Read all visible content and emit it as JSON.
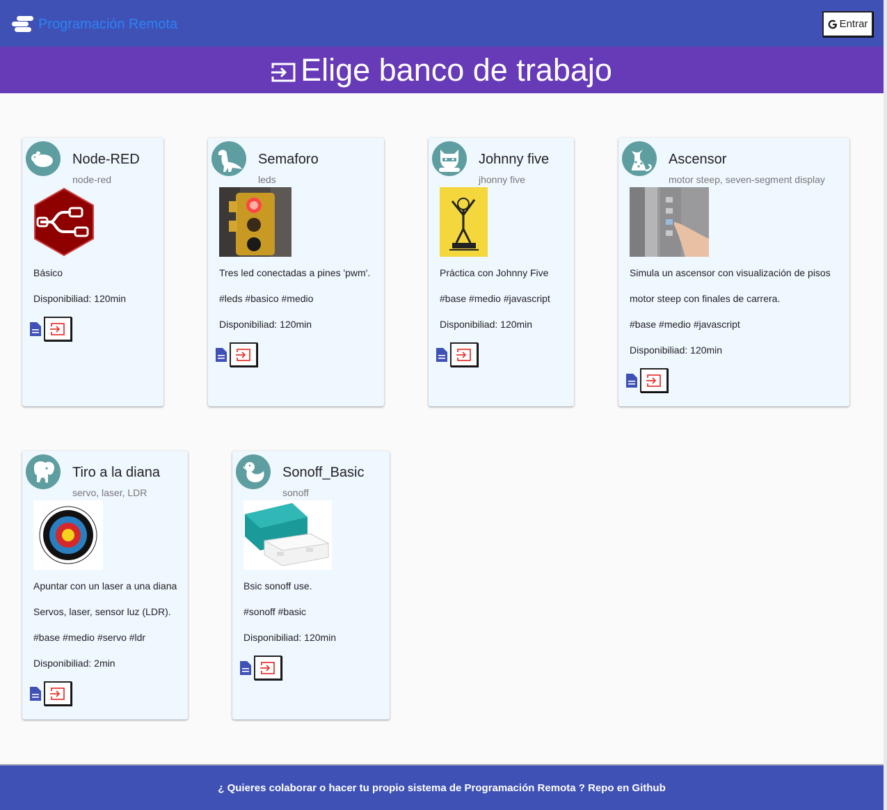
{
  "header": {
    "brand": "Programación Remota",
    "login_label": "Entrar",
    "brand_color": "#2b83f6",
    "bar_color": "#3f51b5"
  },
  "title_bar": {
    "title": "Elige banco de trabajo",
    "icon": "enter-icon",
    "color": "#673ab7"
  },
  "cards": [
    {
      "title": "Node-RED",
      "subtitle": "node-red",
      "avatar": "hamster-avatar",
      "lines": [
        "Básico",
        "Disponibiliad: 120min"
      ]
    },
    {
      "title": "Semaforo",
      "subtitle": "leds",
      "avatar": "dinosaur-avatar",
      "lines": [
        "Tres led conectadas a pines 'pwm'.",
        "#leds #basico #medio",
        "Disponibiliad: 120min"
      ]
    },
    {
      "title": "Johnny five",
      "subtitle": "jhonny five",
      "avatar": "raccoon-avatar",
      "lines": [
        "Práctica con Johnny Five",
        "#base #medio #javascript",
        "Disponibiliad: 120min"
      ]
    },
    {
      "title": "Ascensor",
      "subtitle": "motor steep, seven-segment display",
      "avatar": "leopard-avatar",
      "lines": [
        "Simula un ascensor con visualización de pisos",
        "motor steep con finales de carrera.",
        "#base #medio #javascript",
        "Disponibiliad: 120min"
      ]
    },
    {
      "title": "Tiro a la diana",
      "subtitle": "servo, laser, LDR",
      "avatar": "elephant-avatar",
      "lines": [
        "Apuntar con un laser a una diana",
        "Servos, laser, sensor luz (LDR).",
        "#base #medio #servo #ldr",
        "Disponibiliad: 2min"
      ]
    },
    {
      "title": "Sonoff_Basic",
      "subtitle": "sonoff",
      "avatar": "duck-avatar",
      "lines": [
        "Bsic sonoff use.",
        "#sonoff #basic",
        "Disponibiliad: 120min"
      ]
    }
  ],
  "footer": {
    "text": "¿ Quieres colaborar o hacer tu propio sistema de Programación Remota ? Repo en Github"
  }
}
